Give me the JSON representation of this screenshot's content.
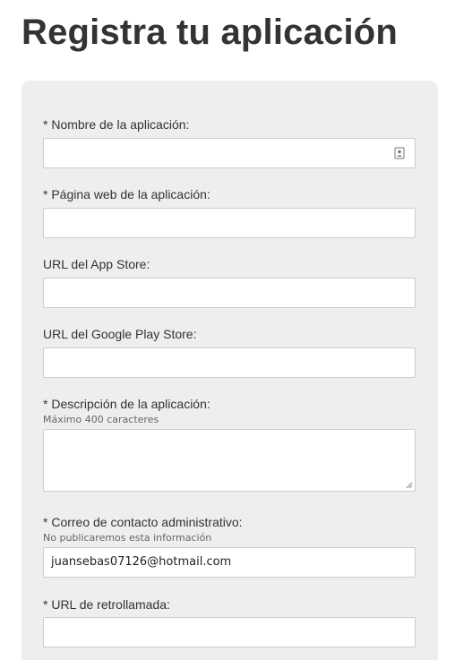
{
  "page": {
    "title": "Registra tu aplicación"
  },
  "form": {
    "app_name": {
      "label": "* Nombre de la aplicación:",
      "value": "",
      "icon": "contact-card-icon"
    },
    "app_website": {
      "label": "* Página web de la aplicación:",
      "value": ""
    },
    "app_store_url": {
      "label": "URL del App Store:",
      "value": ""
    },
    "google_play_url": {
      "label": "URL del Google Play Store:",
      "value": ""
    },
    "description": {
      "label": "* Descripción de la aplicación:",
      "hint": "Máximo 400 caracteres",
      "value": ""
    },
    "admin_email": {
      "label": "* Correo de contacto administrativo:",
      "hint": "No publicaremos esta información",
      "value": "juansebas07126@hotmail.com"
    },
    "callback_url": {
      "label": "* URL de retrollamada:",
      "value": ""
    }
  },
  "colors": {
    "panel_background": "#eeeeee",
    "text": "#333333",
    "input_border": "#cccccc"
  }
}
